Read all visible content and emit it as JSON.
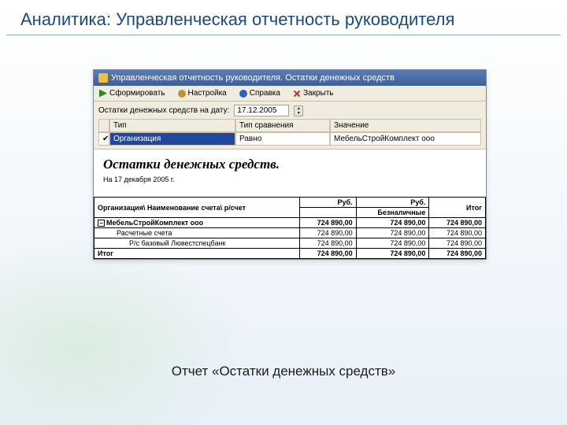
{
  "slide": {
    "title": "Аналитика: Управленческая отчетность руководителя",
    "caption": "Отчет «Остатки денежных средств»"
  },
  "window": {
    "title": "Управленческая отчетность руководителя. Остатки денежных средств"
  },
  "toolbar": {
    "run": "Сформировать",
    "settings": "Настройка",
    "help": "Справка",
    "close": "Закрыть"
  },
  "params": {
    "date_label": "Остатки денежных средств на дату:",
    "date_value": "17.12.2005"
  },
  "filter": {
    "headers": {
      "type": "Тип",
      "compare": "Тип сравнения",
      "value": "Значение"
    },
    "row": {
      "checked": "✔",
      "type": "Организация",
      "compare": "Равно",
      "value": "МебельСтройКомплект ооо"
    }
  },
  "report": {
    "title": "Остатки денежных средств.",
    "subtitle": "На 17 декабря 2005 г.",
    "col_main": "Организация\\ Наименование счета\\ р/счет",
    "col_c1": "Руб.",
    "col_c2": "Руб.",
    "col_c3": "Итог",
    "sub_c2": "Безналичные",
    "rows": [
      {
        "label": "МебельСтройКомплект ооо",
        "c1": "724 890,00",
        "c2": "724 890,00",
        "c3": "724 890,00",
        "bold": true,
        "toggle": "−"
      },
      {
        "label": "Расчетные счета",
        "c1": "724 890,00",
        "c2": "724 890,00",
        "c3": "724 890,00",
        "indent": 1
      },
      {
        "label": "Р/с базовый Лювестспецбанк",
        "c1": "724 890,00",
        "c2": "724 890,00",
        "c3": "724 890,00",
        "indent": 2
      }
    ],
    "total": {
      "label": "Итог",
      "c1": "724 890,00",
      "c2": "724 890,00",
      "c3": "724 890,00"
    }
  }
}
